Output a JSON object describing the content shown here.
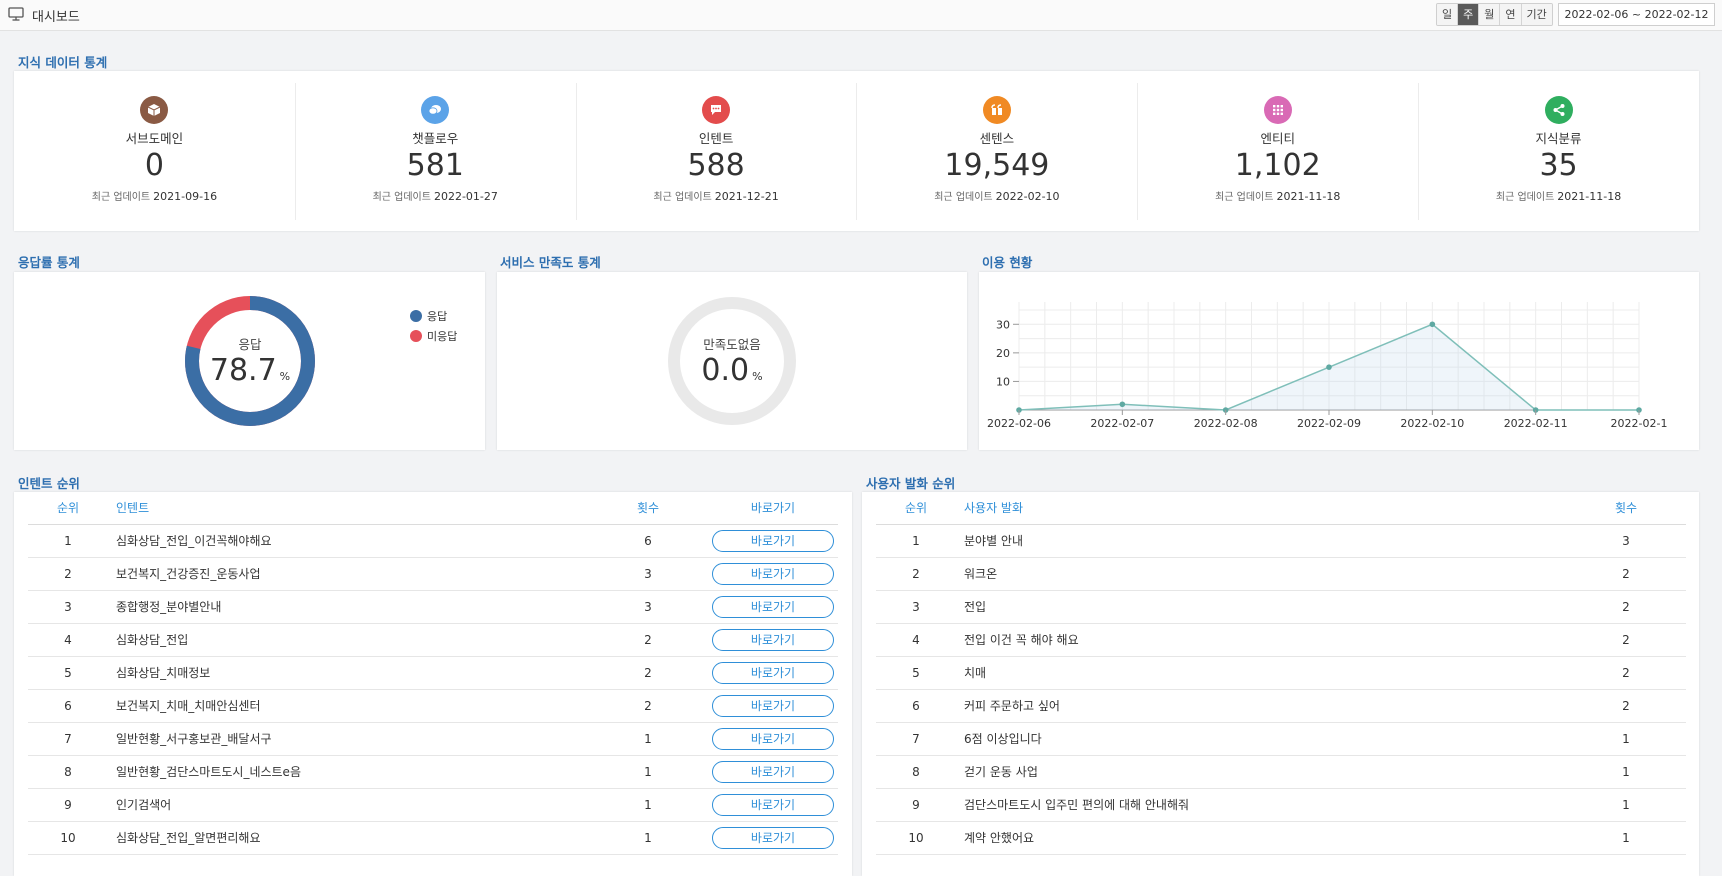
{
  "header": {
    "title": "대시보드",
    "periods": [
      {
        "label": "일",
        "active": false
      },
      {
        "label": "주",
        "active": true
      },
      {
        "label": "월",
        "active": false
      },
      {
        "label": "연",
        "active": false
      },
      {
        "label": "기간",
        "active": false
      }
    ],
    "date_range": "2022-02-06 ~ 2022-02-12"
  },
  "knowledge": {
    "title": "지식 데이터 통계",
    "updated_prefix": "최근 업데이트",
    "items": [
      {
        "label": "서브도메인",
        "value": "0",
        "date": "2021-09-16",
        "color": "#8a5a44",
        "icon": "box-icon"
      },
      {
        "label": "챗플로우",
        "value": "581",
        "date": "2022-01-27",
        "color": "#5ba3e8",
        "icon": "chat-bubble-icon"
      },
      {
        "label": "인텐트",
        "value": "588",
        "date": "2021-12-21",
        "color": "#e34c4c",
        "icon": "message-dots-icon"
      },
      {
        "label": "센텐스",
        "value": "19,549",
        "date": "2022-02-10",
        "color": "#f08a24",
        "icon": "quote-icon"
      },
      {
        "label": "엔티티",
        "value": "1,102",
        "date": "2021-11-18",
        "color": "#d96ab5",
        "icon": "grid-icon"
      },
      {
        "label": "지식분류",
        "value": "35",
        "date": "2021-11-18",
        "color": "#2fae5f",
        "icon": "share-icon"
      }
    ]
  },
  "response": {
    "title": "응답률 통계",
    "center_label": "응답",
    "value": "78.7",
    "unit": "%",
    "answered_fraction": 0.787,
    "legend": [
      {
        "label": "응답",
        "color": "#3b6ea5"
      },
      {
        "label": "미응답",
        "color": "#e6505a"
      }
    ]
  },
  "satisfaction": {
    "title": "서비스 만족도 통계",
    "center_label": "만족도없음",
    "value": "0.0",
    "unit": "%"
  },
  "usage": {
    "title": "이용 현황"
  },
  "chart_data": {
    "type": "area",
    "x": [
      "2022-02-06",
      "2022-02-07",
      "2022-02-08",
      "2022-02-09",
      "2022-02-10",
      "2022-02-11",
      "2022-02-12"
    ],
    "x_tick_labels": [
      "2022-02-06",
      "2022-02-07",
      "2022-02-08",
      "2022-02-09",
      "2022-02-10",
      "2022-02-11",
      "2022-02-1"
    ],
    "values": [
      0,
      2,
      0,
      15,
      30,
      0,
      0
    ],
    "yticks": [
      "10",
      "20",
      "30"
    ],
    "ylim": [
      0,
      35
    ],
    "grid": true,
    "line_color": "#7fbfb9"
  },
  "intent_rank": {
    "title": "인텐트 순위",
    "headers": {
      "rank": "순위",
      "name": "인텐트",
      "count": "횟수",
      "go": "바로가기"
    },
    "button_label": "바로가기",
    "rows": [
      {
        "rank": "1",
        "name": "심화상담_전입_이건꼭해야해요",
        "count": "6"
      },
      {
        "rank": "2",
        "name": "보건복지_건강증진_운동사업",
        "count": "3"
      },
      {
        "rank": "3",
        "name": "종합행정_분야별안내",
        "count": "3"
      },
      {
        "rank": "4",
        "name": "심화상담_전입",
        "count": "2"
      },
      {
        "rank": "5",
        "name": "심화상담_치매정보",
        "count": "2"
      },
      {
        "rank": "6",
        "name": "보건복지_치매_치매안심센터",
        "count": "2"
      },
      {
        "rank": "7",
        "name": "일반현황_서구홍보관_배달서구",
        "count": "1"
      },
      {
        "rank": "8",
        "name": "일반현황_검단스마트도시_네스트e음",
        "count": "1"
      },
      {
        "rank": "9",
        "name": "인기검색어",
        "count": "1"
      },
      {
        "rank": "10",
        "name": "심화상담_전입_알면편리해요",
        "count": "1"
      }
    ]
  },
  "utterance_rank": {
    "title": "사용자 발화 순위",
    "headers": {
      "rank": "순위",
      "name": "사용자 발화",
      "count": "횟수"
    },
    "rows": [
      {
        "rank": "1",
        "name": "분야별 안내",
        "count": "3"
      },
      {
        "rank": "2",
        "name": "워크온",
        "count": "2"
      },
      {
        "rank": "3",
        "name": "전입",
        "count": "2"
      },
      {
        "rank": "4",
        "name": "전입 이건 꼭 해야 해요",
        "count": "2"
      },
      {
        "rank": "5",
        "name": "치매",
        "count": "2"
      },
      {
        "rank": "6",
        "name": "커피 주문하고 싶어",
        "count": "2"
      },
      {
        "rank": "7",
        "name": "6점 이상입니다",
        "count": "1"
      },
      {
        "rank": "8",
        "name": "걷기 운동 사업",
        "count": "1"
      },
      {
        "rank": "9",
        "name": "검단스마트도시 입주민 편의에 대해 안내해줘",
        "count": "1"
      },
      {
        "rank": "10",
        "name": "계약 안했어요",
        "count": "1"
      }
    ]
  }
}
